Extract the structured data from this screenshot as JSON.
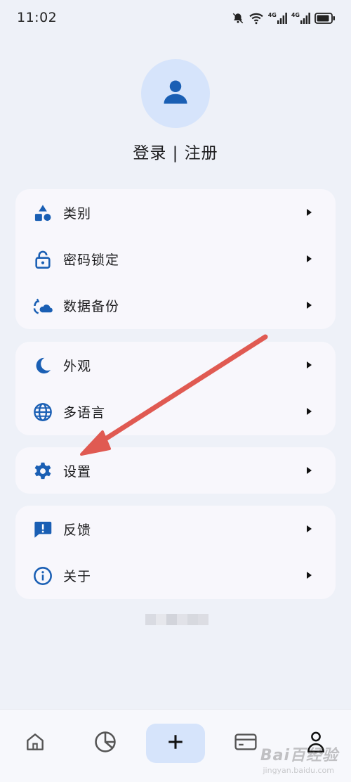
{
  "status_bar": {
    "time": "11:02",
    "icons": [
      "bell-muted-icon",
      "wifi-icon",
      "signal-4g-icon",
      "signal-4g-icon",
      "battery-icon"
    ],
    "network_label_1": "4G",
    "network_label_2": "4G"
  },
  "profile": {
    "avatar_icon": "person-icon",
    "login_text": "登录 | 注册"
  },
  "menu_groups": [
    {
      "items": [
        {
          "icon": "shapes-icon",
          "label": "类别"
        },
        {
          "icon": "lock-icon",
          "label": "密码锁定"
        },
        {
          "icon": "cloud-sync-icon",
          "label": "数据备份"
        }
      ]
    },
    {
      "items": [
        {
          "icon": "moon-icon",
          "label": "外观"
        },
        {
          "icon": "globe-icon",
          "label": "多语言"
        }
      ]
    },
    {
      "items": [
        {
          "icon": "gear-icon",
          "label": "设置"
        }
      ]
    },
    {
      "items": [
        {
          "icon": "feedback-icon",
          "label": "反馈"
        },
        {
          "icon": "info-icon",
          "label": "关于"
        }
      ]
    }
  ],
  "tab_bar": {
    "tabs": [
      {
        "icon": "home-icon"
      },
      {
        "icon": "pie-chart-icon"
      },
      {
        "icon": "add-icon"
      },
      {
        "icon": "card-icon"
      },
      {
        "icon": "profile-icon"
      }
    ]
  },
  "watermark": {
    "text": "Bai百经验",
    "sub": "jingyan.baidu.com"
  },
  "colors": {
    "accent": "#1a5fb4",
    "background": "#eef1f8",
    "card": "#f8f7fc",
    "avatar_bg": "#d6e4fb",
    "arrow": "#e05a52"
  }
}
